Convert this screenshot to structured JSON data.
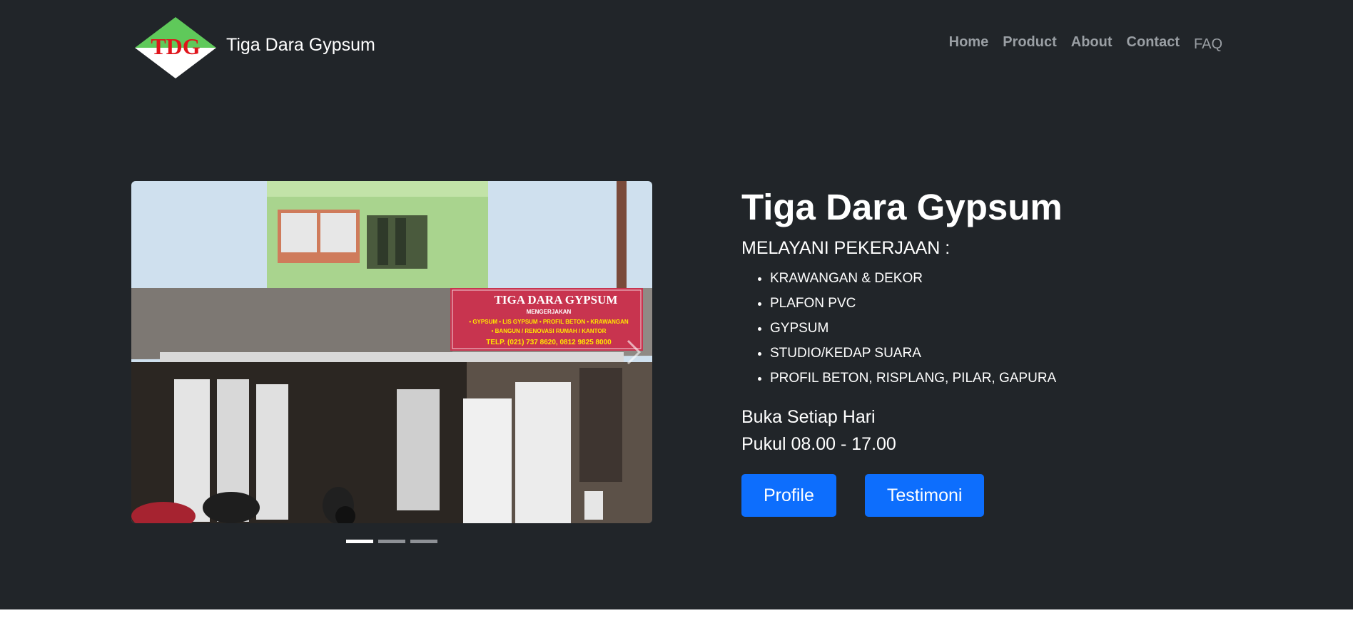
{
  "brand": {
    "logo_text": "TDG",
    "name": "Tiga Dara Gypsum"
  },
  "nav": {
    "items": [
      {
        "label": "Home"
      },
      {
        "label": "Product"
      },
      {
        "label": "About"
      },
      {
        "label": "Contact"
      },
      {
        "label": "FAQ"
      }
    ]
  },
  "carousel": {
    "sign": {
      "title": "TIGA DARA GYPSUM",
      "subtitle": "MENGERJAKAN",
      "line1": "• GYPSUM  • LIS GYPSUM  • PROFIL BETON  • KRAWANGAN",
      "line2": "• BANGUN / RENOVASI RUMAH / KANTOR",
      "phone": "TELP. (021) 737 8620, 0812 9825 8000"
    },
    "slide_count": 3,
    "active_index": 0
  },
  "hero": {
    "title": "Tiga Dara Gypsum",
    "subtitle": "MELAYANI PEKERJAAN :",
    "services": [
      "KRAWANGAN & DEKOR",
      "PLAFON PVC",
      "GYPSUM",
      "STUDIO/KEDAP SUARA",
      "PROFIL BETON, RISPLANG, PILAR, GAPURA"
    ],
    "hours_line1": "Buka Setiap Hari",
    "hours_line2": "Pukul 08.00 - 17.00"
  },
  "buttons": {
    "profile": "Profile",
    "testimoni": "Testimoni"
  },
  "colors": {
    "hero_bg": "#212529",
    "primary": "#0d6efd",
    "nav_link": "#9a9fa4",
    "logo_green": "#5fc95a",
    "logo_red": "#e0141b"
  }
}
